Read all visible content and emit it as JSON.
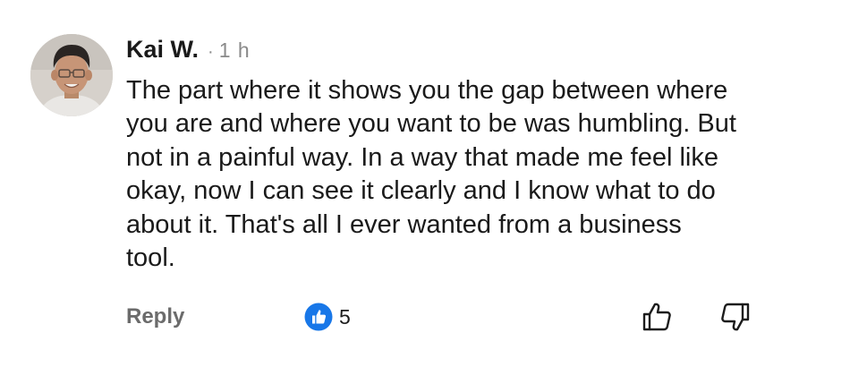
{
  "comment": {
    "author": "Kai W.",
    "separator": "·",
    "timestamp": "1 h",
    "lines": [
      "The part where it shows you the gap between where",
      "you are and where you want to be was humbling. But",
      "not in a painful way. In a way that made me feel like",
      "okay, now I can see it clearly and I know what to do",
      "about it. That's all I ever wanted from a business",
      "tool."
    ]
  },
  "actions": {
    "reply_label": "Reply",
    "reaction_icon": "thumbs-up-badge-icon",
    "reaction_count": "5",
    "like_icon": "thumbs-up-outline-icon",
    "dislike_icon": "thumbs-down-outline-icon"
  },
  "colors": {
    "text": "#1a1a1a",
    "muted": "#8a8a8a",
    "reply": "#6b6b6b",
    "reaction_blue": "#1877e8"
  }
}
